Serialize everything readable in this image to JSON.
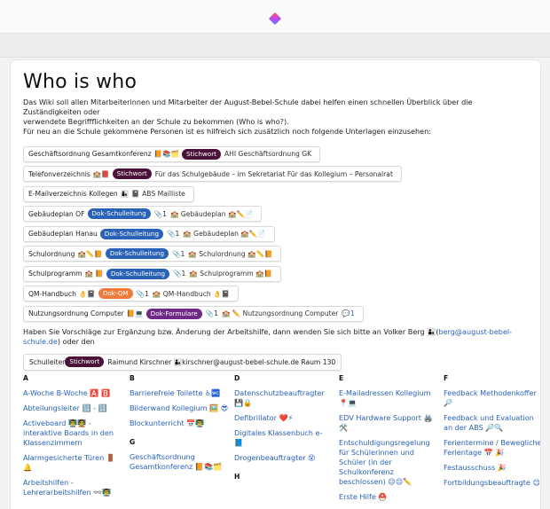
{
  "page": {
    "title": "Who is who",
    "intro_line1": "Das Wiki soll allen Mitarbeiterinnen und Mitarbeiter der August-Bebel-Schule dabei helfen einen schnellen Überblick über die Zuständigkeiten oder",
    "intro_line2": "verwendete Begriffflichkeiten an der Schule zu bekommen (Who is who?).",
    "intro_line3": "Für neu an die Schule gekommene Personen ist es hilfreich sich zusätzlich noch folgende Unterlagen einzusehen:"
  },
  "rows": [
    {
      "label": "Geschäftsordnung Gesamtkonferenz",
      "emoji": "📙📚🗂️",
      "tag": "Stichwort",
      "tag_kind": "stich",
      "extra": "AHI Geschäftsordnung GK"
    },
    {
      "label": "Telefonverzeichnis",
      "emoji": "🏫📕",
      "tag": "Stichwort",
      "tag_kind": "stich",
      "extra": "Für das Schulgebäude – im Sekretariat Für das Kollegium – Personalrat"
    },
    {
      "label": "E-Mailverzeichnis Kollegen",
      "emoji": "👩‍👦",
      "extra": "📓 ABS Mailliste"
    },
    {
      "label": "Gebäudeplan OF",
      "tag": "Dok-Schulleitung",
      "tag_kind": "schul",
      "count": "📎1",
      "extra": "🏫 Gebäudeplan 🏫✏️📄"
    },
    {
      "label": "Gebäudeplan Hanau",
      "tag": "Dok-Schulleitung",
      "tag_kind": "schul",
      "count": "📎1",
      "extra": "🏫 Gebäudeplan 🏫✏️📄"
    },
    {
      "label": "Schulordnung",
      "emoji": "🏫📏📙",
      "tag": "Dok-Schulleitung",
      "tag_kind": "schul",
      "count": "📎1",
      "extra": "🏫 Schulordnung 🏫📏📙"
    },
    {
      "label": "Schulprogramm",
      "emoji": "🏫 📙",
      "tag": "Dok-Schulleitung",
      "tag_kind": "schul",
      "count": "📎1",
      "extra": "🏫 Schulprogramm 🏫📙"
    },
    {
      "label": "QM-Handbuch",
      "emoji": "👌📓",
      "tag": "Dok-QM",
      "tag_kind": "qm",
      "count": "📎1",
      "extra": "🏫 QM-Handbuch 👌📓"
    },
    {
      "label": "Nutzungsordnung Computer",
      "emoji": "📙💻",
      "tag": "Dok-Formulare",
      "tag_kind": "form",
      "count": "📎1",
      "extra": "🏫 ✏️ Nutzungsordnung Computer",
      "comments": "💬1"
    }
  ],
  "vorschlag": {
    "text1": "Haben Sie Vorschläge zur Ergänzung bzw. Änderung der Arbeitshilfe, dann wenden Sie sich bitte an Volker Berg 👨‍👦(",
    "link": "berg@august-bebel-schule.de",
    "text2": ") oder den"
  },
  "schulleiter": {
    "label": "Schulleiter",
    "tag": "Stichwort",
    "extra": "Raimund Kirschner 👨‍👦kirschner@august-bebel-schule.de Raum 130"
  },
  "index": [
    {
      "letter": "A",
      "items": [
        "A-Woche B-Woche 🅰️ 🅱️",
        "Abteilungsleiter 🔢 - 🔢",
        "Activeboard 👨‍🏫🧑‍🏫 - interaktive Boards in den Klassenzimmern",
        "Alarmgesicherte Türen 🚪🔔",
        "Arbeitshilfen - Lehrerarbeitshilfen 👓👨‍🏫"
      ]
    },
    {
      "letter": "B",
      "items": [
        "Barrierefreie Toilette ♿🚾",
        "Bilderwand Kollegium 🖼️ 😎",
        "Blockunterricht 📅👨‍🏫"
      ],
      "sub_letter": "G",
      "sub_items": [
        "Geschäftsordnung Gesamtkonferenz 📙📚🗂️"
      ]
    },
    {
      "letter": "D",
      "items": [
        "Datenschutzbeauftragter 💾🔒",
        "Defibrillator ❤️⚡",
        "Digitales Klassenbuch e- 📘",
        "Drogenbeauftragter 😵"
      ],
      "sub_letter": "H",
      "sub_items": []
    },
    {
      "letter": "E",
      "items": [
        "E-Mailadressen Kollegium 📍💻",
        "EDV Hardware Support 🖨️ 🛠️",
        "Entschuldigungsregelung für Schülerinnen und Schüler (in der Schulkonferenz beschlossen) 😔😔✏️",
        "Erste Hilfe ⛑️"
      ]
    },
    {
      "letter": "F",
      "items": [
        "Feedback Methodenkoffer 🔎",
        "Feedback und Evaluation an der ABS 🔎🔍",
        "Ferientermine / Bewegliche Ferientage 📅 🎉",
        "Festausschuss 🎉",
        "Fortbildungsbeauftragte 😊"
      ]
    }
  ]
}
